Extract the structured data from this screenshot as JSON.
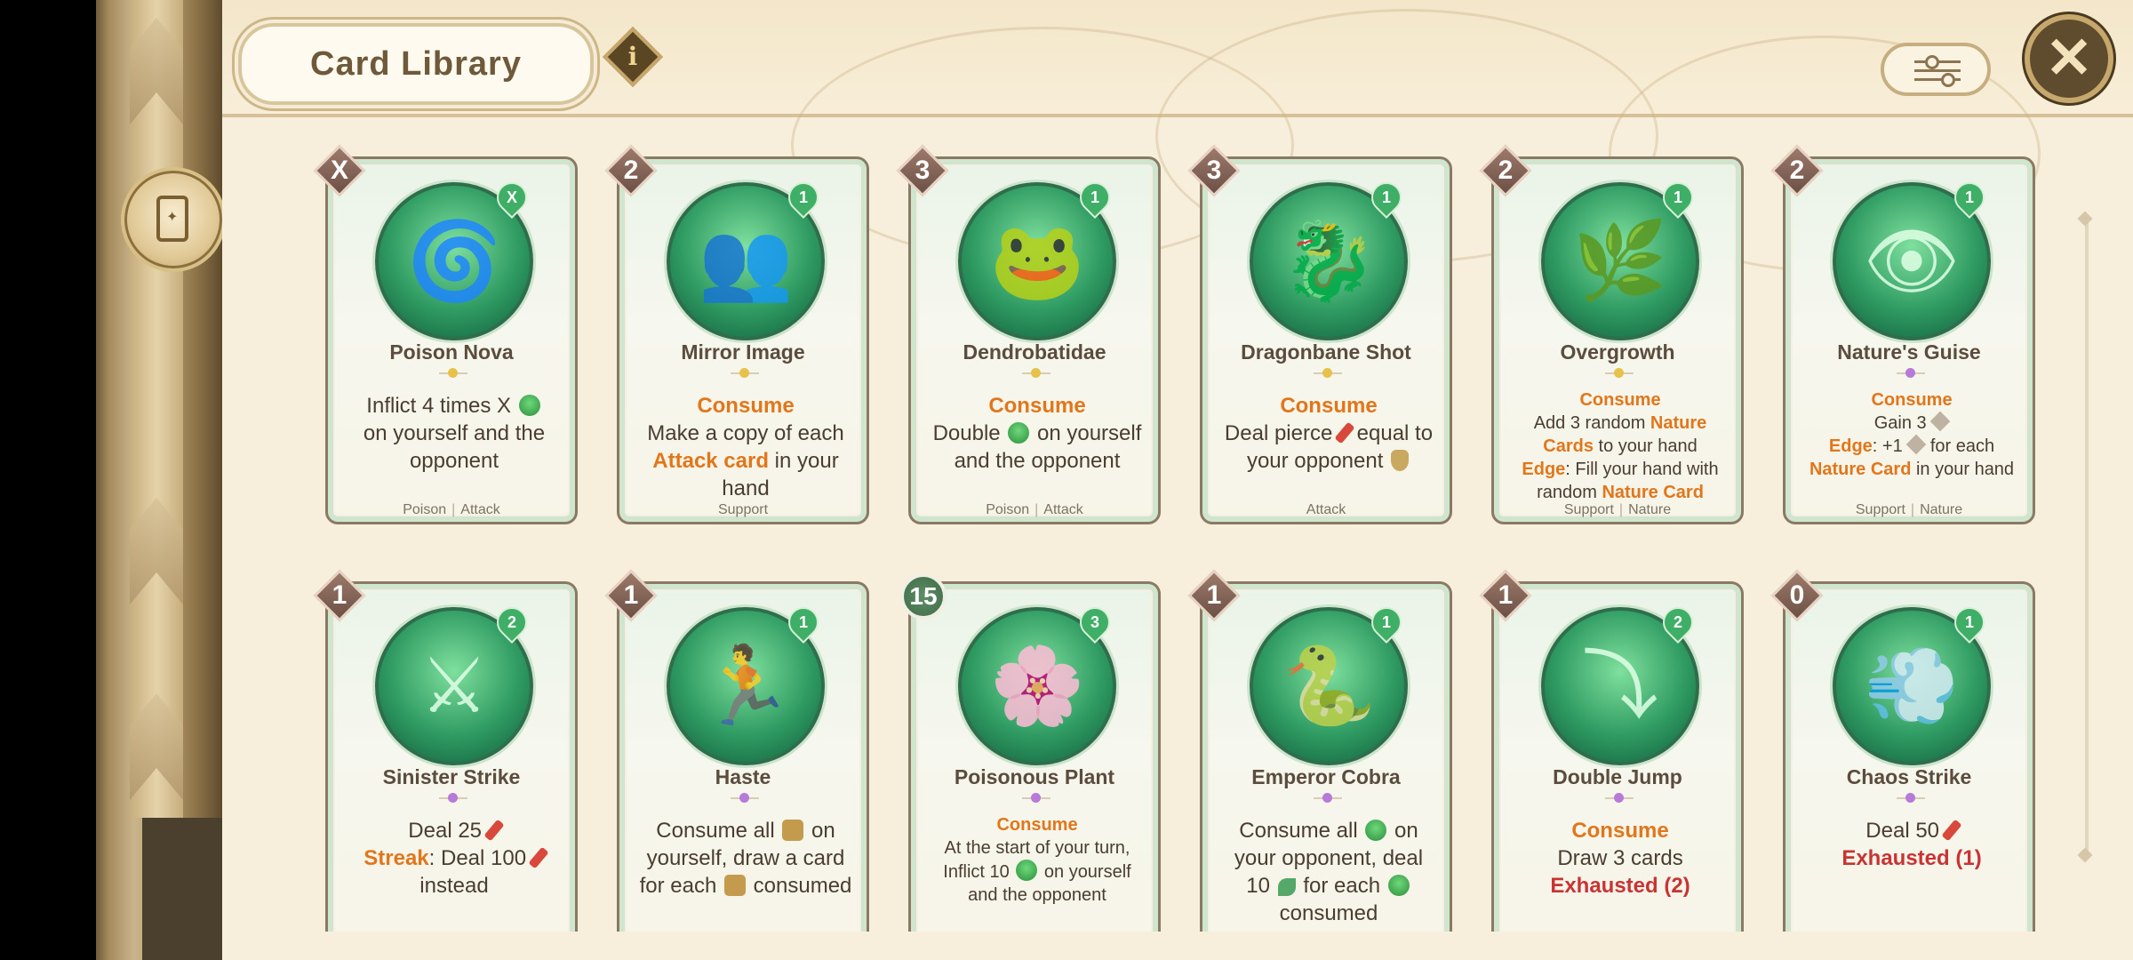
{
  "header": {
    "title": "Card Library",
    "info_label": "i",
    "close_label": "✕"
  },
  "cards": [
    {
      "name": "Poison Nova",
      "cost": "X",
      "energy": "X",
      "tags": [
        "Poison",
        "Attack"
      ],
      "gem": "#e7c24a",
      "desc": [
        {
          "t": "Inflict 4 times X "
        },
        {
          "icon": "poison"
        },
        {
          "br": 1
        },
        {
          "t": "on yourself and the opponent"
        }
      ]
    },
    {
      "name": "Mirror Image",
      "cost": "2",
      "energy": "1",
      "tags": [
        "Support"
      ],
      "gem": "#e7c24a",
      "desc": [
        {
          "t": "Consume",
          "c": "kw"
        },
        {
          "br": 1
        },
        {
          "t": "Make a copy of each "
        },
        {
          "t": "Attack card",
          "c": "kw"
        },
        {
          "t": " in your hand"
        }
      ]
    },
    {
      "name": "Dendrobatidae",
      "cost": "3",
      "energy": "1",
      "tags": [
        "Poison",
        "Attack"
      ],
      "gem": "#e7c24a",
      "desc": [
        {
          "t": "Consume",
          "c": "kw"
        },
        {
          "br": 1
        },
        {
          "t": "Double "
        },
        {
          "icon": "poison"
        },
        {
          "t": " on yourself and the opponent"
        }
      ]
    },
    {
      "name": "Dragonbane Shot",
      "cost": "3",
      "energy": "1",
      "tags": [
        "Attack"
      ],
      "gem": "#e7c24a",
      "desc": [
        {
          "t": "Consume",
          "c": "kw"
        },
        {
          "br": 1
        },
        {
          "t": "Deal pierce "
        },
        {
          "icon": "sword"
        },
        {
          "t": " equal to your opponent "
        },
        {
          "icon": "shield"
        }
      ]
    },
    {
      "name": "Overgrowth",
      "cost": "2",
      "energy": "1",
      "tags": [
        "Support",
        "Nature"
      ],
      "gem": "#e7c24a",
      "small": true,
      "desc": [
        {
          "t": "Consume",
          "c": "kw"
        },
        {
          "br": 1
        },
        {
          "t": "Add 3 random "
        },
        {
          "t": "Nature Cards",
          "c": "kw"
        },
        {
          "t": " to your hand"
        },
        {
          "br": 1
        },
        {
          "t": "Edge",
          "c": "kw"
        },
        {
          "t": ": Fill your hand with random "
        },
        {
          "t": "Nature Card",
          "c": "kw"
        }
      ]
    },
    {
      "name": "Nature's Guise",
      "cost": "2",
      "energy": "1",
      "tags": [
        "Support",
        "Nature"
      ],
      "gem": "#b77ad9",
      "small": true,
      "desc": [
        {
          "t": "Consume",
          "c": "kw"
        },
        {
          "br": 1
        },
        {
          "t": "Gain 3 "
        },
        {
          "icon": "diamond"
        },
        {
          "br": 1
        },
        {
          "t": "Edge",
          "c": "kw"
        },
        {
          "t": ": +1 "
        },
        {
          "icon": "diamond"
        },
        {
          "t": " for each "
        },
        {
          "t": "Nature Card",
          "c": "kw"
        },
        {
          "t": " in your hand"
        }
      ]
    },
    {
      "name": "Sinister Strike",
      "cost": "1",
      "energy": "2",
      "tags": [],
      "gem": "#b77ad9",
      "desc": [
        {
          "t": "Deal 25 "
        },
        {
          "icon": "sword"
        },
        {
          "br": 1
        },
        {
          "t": "Streak",
          "c": "kw"
        },
        {
          "t": ": Deal 100 "
        },
        {
          "icon": "sword"
        },
        {
          "t": " instead"
        }
      ]
    },
    {
      "name": "Haste",
      "cost": "1",
      "energy": "1",
      "tags": [],
      "gem": "#b77ad9",
      "desc": [
        {
          "t": "Consume all "
        },
        {
          "icon": "fist"
        },
        {
          "t": " on yourself, draw a card for each "
        },
        {
          "icon": "fist"
        },
        {
          "t": " consumed"
        }
      ]
    },
    {
      "name": "Poisonous Plant",
      "cost": "15",
      "energy": "3",
      "round": true,
      "tags": [],
      "gem": "#b77ad9",
      "small": true,
      "desc": [
        {
          "t": "Consume",
          "c": "kw"
        },
        {
          "br": 1
        },
        {
          "t": "At the start of your turn, Inflict 10 "
        },
        {
          "icon": "poison"
        },
        {
          "t": " on yourself and the opponent"
        }
      ]
    },
    {
      "name": "Emperor Cobra",
      "cost": "1",
      "energy": "1",
      "tags": [],
      "gem": "#b77ad9",
      "desc": [
        {
          "t": "Consume all "
        },
        {
          "icon": "poison"
        },
        {
          "t": " on your opponent, deal 10 "
        },
        {
          "icon": "leaf"
        },
        {
          "t": " for each "
        },
        {
          "icon": "poison"
        },
        {
          "t": " consumed"
        }
      ]
    },
    {
      "name": "Double Jump",
      "cost": "1",
      "energy": "2",
      "tags": [],
      "gem": "#b77ad9",
      "desc": [
        {
          "t": "Consume",
          "c": "kw"
        },
        {
          "br": 1
        },
        {
          "t": "Draw 3 cards"
        },
        {
          "br": 1
        },
        {
          "t": "Exhausted (2)",
          "c": "red"
        }
      ]
    },
    {
      "name": "Chaos Strike",
      "cost": "0",
      "energy": "1",
      "tags": [],
      "gem": "#b77ad9",
      "desc": [
        {
          "t": "Deal 50 "
        },
        {
          "icon": "sword"
        },
        {
          "br": 1
        },
        {
          "t": "Exhausted (1)",
          "c": "red"
        }
      ]
    }
  ],
  "art_glyphs": [
    "🌀",
    "👥",
    "🐸",
    "🐉",
    "🌿",
    "👁",
    "⚔",
    "🏃",
    "🌸",
    "🐍",
    "⤵",
    "💨"
  ]
}
